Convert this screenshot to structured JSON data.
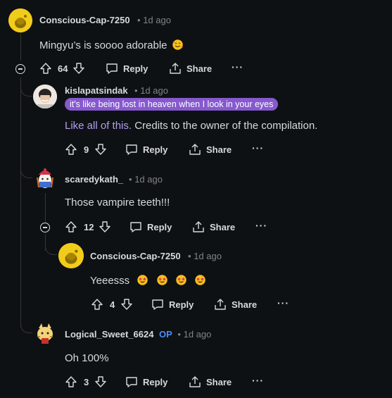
{
  "comments": [
    {
      "username": "Conscious-Cap-7250",
      "age": "1d ago",
      "body": "Mingyu’s is soooo adorable",
      "votes": "64",
      "reply": "Reply",
      "share": "Share",
      "more": "···"
    },
    {
      "username": "kislapatsindak",
      "age": "1d ago",
      "flair": "it's like being lost in heaven when I look in your eyes",
      "link": "Like all of this.",
      "body": " Credits to the owner of the compilation.",
      "votes": "9",
      "reply": "Reply",
      "share": "Share",
      "more": "···"
    },
    {
      "username": "scaredykath_",
      "age": "1d ago",
      "body": "Those vampire teeth!!!",
      "votes": "12",
      "reply": "Reply",
      "share": "Share",
      "more": "···"
    },
    {
      "username": "Conscious-Cap-7250",
      "age": "1d ago",
      "body": "Yeeesss",
      "votes": "4",
      "reply": "Reply",
      "share": "Share",
      "more": "···"
    },
    {
      "username": "Logical_Sweet_6624",
      "op_badge": "OP",
      "age": "1d ago",
      "body": "Oh 100%",
      "votes": "3",
      "reply": "Reply",
      "share": "Share",
      "more": "···"
    }
  ],
  "separator": "•",
  "colors": {
    "background": "#0e1113",
    "flair": "#8659cf",
    "op": "#4a8cff",
    "link": "#b49cf0"
  }
}
